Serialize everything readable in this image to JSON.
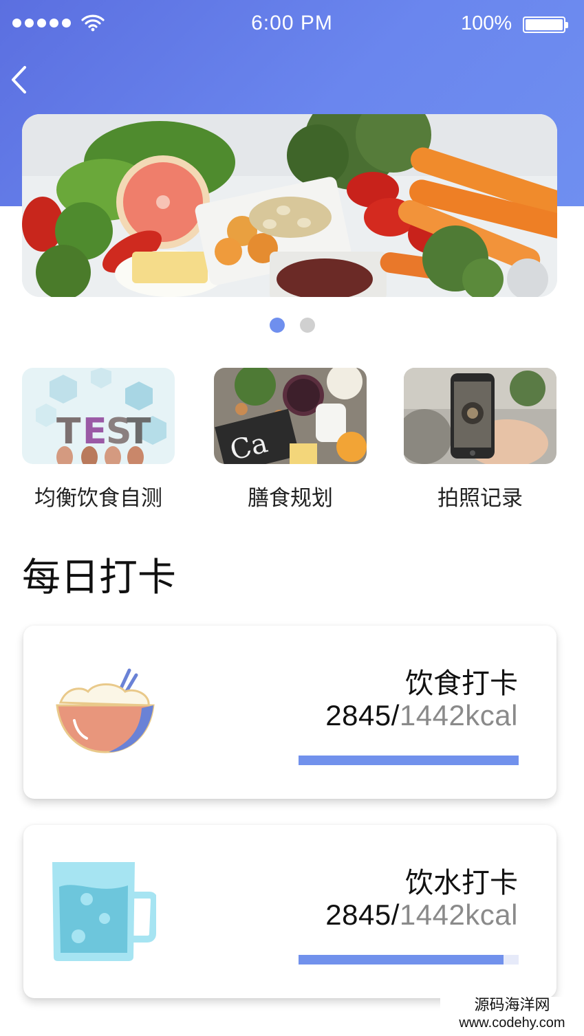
{
  "status_bar": {
    "time": "6:00 PM",
    "battery": "100%",
    "signal_icon": "signal-dots-icon",
    "wifi_icon": "wifi-icon",
    "battery_icon": "battery-icon"
  },
  "nav": {
    "back_icon": "chevron-left-icon"
  },
  "banner": {
    "image": "fresh vegetables, fruit and nuts",
    "pages": 2,
    "active_page": 1
  },
  "features": [
    {
      "label": "均衡饮食自测",
      "image": "TEST letters held by hands"
    },
    {
      "label": "膳食规划",
      "image": "calcium foods with Ca chalkboard"
    },
    {
      "label": "拍照记录",
      "image": "phone photographing a meal"
    }
  ],
  "section": {
    "title": "每日打卡"
  },
  "cards": [
    {
      "title": "饮食打卡",
      "current": "2845/",
      "target": "1442kcal",
      "icon": "rice-bowl-icon",
      "progress": 1.0
    },
    {
      "title": "饮水打卡",
      "current": "2845/",
      "target": "1442kcal",
      "icon": "water-cup-icon",
      "progress": 0.93
    }
  ],
  "watermark": {
    "title": "源码海洋网",
    "url": "www.codehy.com"
  },
  "colors": {
    "header_start": "#5b6fe0",
    "header_end": "#6f8ff0",
    "accent": "#7191ec",
    "dot_inactive": "#d0d0d0",
    "muted_text": "#8a8a8a"
  }
}
